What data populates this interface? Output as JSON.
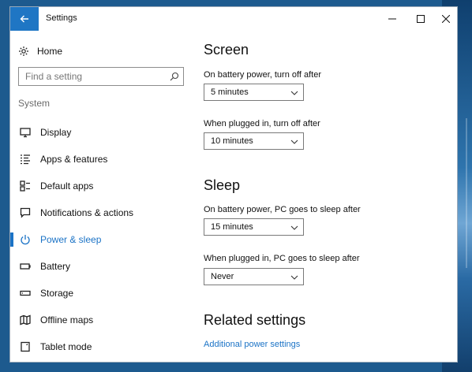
{
  "window": {
    "title": "Settings"
  },
  "sidebar": {
    "home_label": "Home",
    "search_placeholder": "Find a setting",
    "section_label": "System",
    "items": [
      {
        "label": "Display",
        "icon": "display-icon"
      },
      {
        "label": "Apps & features",
        "icon": "apps-list-icon"
      },
      {
        "label": "Default apps",
        "icon": "default-apps-icon"
      },
      {
        "label": "Notifications & actions",
        "icon": "notifications-icon"
      },
      {
        "label": "Power & sleep",
        "icon": "power-icon",
        "active": true
      },
      {
        "label": "Battery",
        "icon": "battery-icon"
      },
      {
        "label": "Storage",
        "icon": "storage-icon"
      },
      {
        "label": "Offline maps",
        "icon": "map-icon"
      },
      {
        "label": "Tablet mode",
        "icon": "tablet-icon"
      }
    ]
  },
  "main": {
    "screen": {
      "heading": "Screen",
      "battery_label": "On battery power, turn off after",
      "battery_value": "5 minutes",
      "plugged_label": "When plugged in, turn off after",
      "plugged_value": "10 minutes"
    },
    "sleep": {
      "heading": "Sleep",
      "battery_label": "On battery power, PC goes to sleep after",
      "battery_value": "15 minutes",
      "plugged_label": "When plugged in, PC goes to sleep after",
      "plugged_value": "Never"
    },
    "related": {
      "heading": "Related settings",
      "link": "Additional power settings"
    }
  },
  "colors": {
    "accent": "#1b73c6",
    "back_button": "#1f76c4"
  }
}
